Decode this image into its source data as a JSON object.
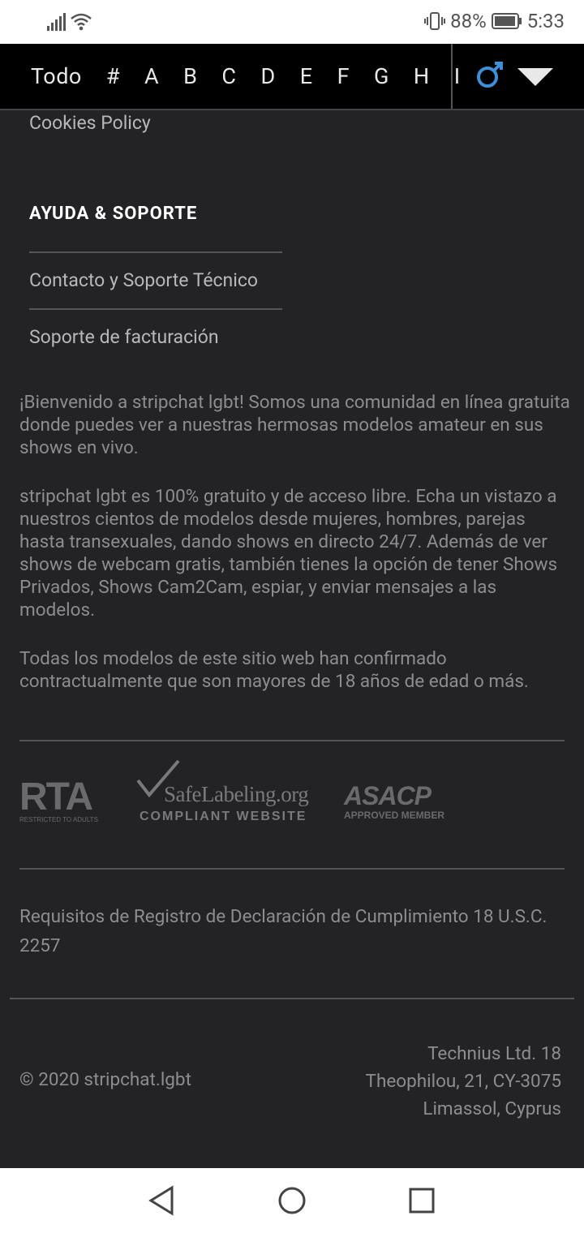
{
  "status_bar": {
    "battery": "88%",
    "time": "5:33"
  },
  "letter_nav": {
    "items": [
      "Todo",
      "#",
      "A",
      "B",
      "C",
      "D",
      "E",
      "F",
      "G",
      "H",
      "I"
    ]
  },
  "footer": {
    "cookies_policy": "Cookies Policy",
    "help_title": "AYUDA & SOPORTE",
    "contact_link": "Contacto y Soporte Técnico",
    "billing_link": "Soporte de facturación",
    "paragraph1": "¡Bienvenido a stripchat lgbt! Somos una comunidad en línea gratuita donde puedes ver a nuestras hermosas modelos amateur en sus shows en vivo.",
    "paragraph2": "stripchat lgbt es 100% gratuito y de acceso libre. Echa un vistazo a nuestros cientos de modelos desde mujeres, hombres, parejas hasta transexuales, dando shows en directo 24/7. Además de ver shows de webcam gratis, también tienes la opción de tener Shows Privados, Shows Cam2Cam, espiar, y enviar mensajes a las modelos.",
    "paragraph3": "Todas los modelos de este sitio web han confirmado contractualmente que son mayores de 18 años de edad o más.",
    "compliance_link": "Requisitos de Registro de Declaración de Cumplimiento 18 U.S.C. 2257",
    "copyright": "© 2020 stripchat.lgbt",
    "address_line1": "Technius Ltd. 18",
    "address_line2": "Theophilou, 21, CY-3075",
    "address_line3": "Limassol, Cyprus"
  },
  "logos": {
    "rta_main": "RTA",
    "rta_sub": "RESTRICTED TO ADULTS",
    "safelabeling_main": "SafeLabeling.org",
    "safelabeling_sub": "COMPLIANT WEBSITE",
    "asacp_main": "ASACP",
    "asacp_sub": "APPROVED MEMBER"
  },
  "colors": {
    "background": "#232325",
    "text_muted": "#8d8d8f",
    "accent_blue": "#3f8fd8"
  }
}
